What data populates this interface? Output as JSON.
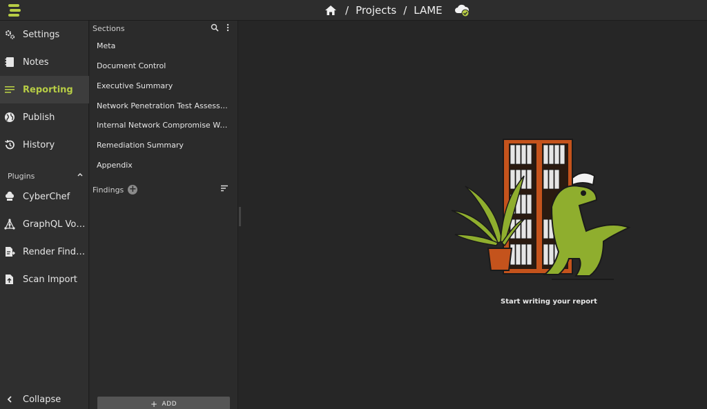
{
  "breadcrumb": {
    "projects": "Projects",
    "project": "LAME",
    "sep1": "/",
    "sep2": "/"
  },
  "nav": {
    "items": [
      {
        "label": "Settings",
        "icon": "gear-icon"
      },
      {
        "label": "Notes",
        "icon": "notes-icon"
      },
      {
        "label": "Reporting",
        "icon": "reporting-icon",
        "active": true
      },
      {
        "label": "Publish",
        "icon": "globe-icon"
      },
      {
        "label": "History",
        "icon": "history-icon"
      }
    ],
    "plugins_label": "Plugins",
    "plugins": [
      {
        "label": "CyberChef",
        "icon": "chef-hat-icon"
      },
      {
        "label": "GraphQL Voyager",
        "icon": "graph-icon"
      },
      {
        "label": "Render Findings",
        "icon": "file-export-icon"
      },
      {
        "label": "Scan Import",
        "icon": "file-upload-icon"
      }
    ],
    "collapse_label": "Collapse"
  },
  "sections": {
    "title": "Sections",
    "items": [
      "Meta",
      "Document Control",
      "Executive Summary",
      "Network Penetration Test Assessment",
      "Internal Network Compromise Walkthrough",
      "Remediation Summary",
      "Appendix"
    ],
    "findings_label": "Findings",
    "add_label": "ADD"
  },
  "main": {
    "empty_text": "Start writing your report"
  },
  "colors": {
    "accent": "#b7cd45",
    "background": "#262626"
  }
}
